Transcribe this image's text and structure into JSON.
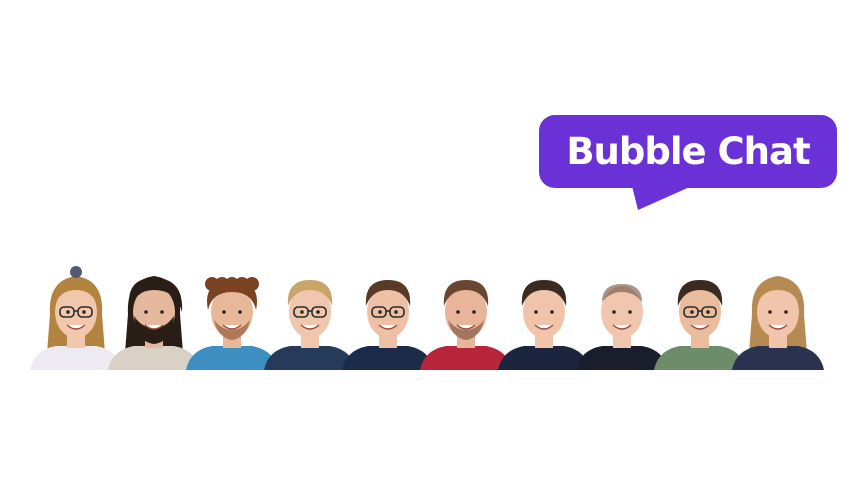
{
  "logo": {
    "text": "Bubble Chat",
    "bubble_color": "#6a31d6",
    "text_color": "#ffffff"
  },
  "team": {
    "members": [
      {
        "hair": "long-blonde-bun",
        "glasses": true,
        "beard": "none",
        "shirt": "#eeeaf3",
        "skin": "#f1c7ae",
        "hairColor": "#b3843f"
      },
      {
        "hair": "long-dark",
        "glasses": false,
        "beard": "full",
        "shirt": "#d9d0c6",
        "skin": "#e3b89c",
        "hairColor": "#2a1d16"
      },
      {
        "hair": "curly-brown",
        "glasses": false,
        "beard": "short",
        "shirt": "#3c8fc0",
        "skin": "#e8b89a",
        "hairColor": "#7a4322"
      },
      {
        "hair": "short-blonde",
        "glasses": true,
        "beard": "none",
        "shirt": "#263a5c",
        "skin": "#f0c6ae",
        "hairColor": "#c9a56a"
      },
      {
        "hair": "short-brown",
        "glasses": true,
        "beard": "none",
        "shirt": "#1d2b4a",
        "skin": "#eec0a6",
        "hairColor": "#5a3a26"
      },
      {
        "hair": "short-brown",
        "glasses": false,
        "beard": "short",
        "shirt": "#b8243a",
        "skin": "#e8b49a",
        "hairColor": "#6a4630"
      },
      {
        "hair": "short-dark",
        "glasses": false,
        "beard": "none",
        "shirt": "#1b2540",
        "skin": "#efc4aa",
        "hairColor": "#3b2a1f"
      },
      {
        "hair": "buzz",
        "glasses": false,
        "beard": "none",
        "shirt": "#1a1d2b",
        "skin": "#f0c7ae",
        "hairColor": "#6b5040"
      },
      {
        "hair": "short-dark",
        "glasses": true,
        "beard": "none",
        "shirt": "#6c8c6a",
        "skin": "#eabd9f",
        "hairColor": "#3a2a20"
      },
      {
        "hair": "long-light",
        "glasses": false,
        "beard": "none",
        "shirt": "#2a3250",
        "skin": "#f1c5ab",
        "hairColor": "#b68a52"
      }
    ]
  }
}
